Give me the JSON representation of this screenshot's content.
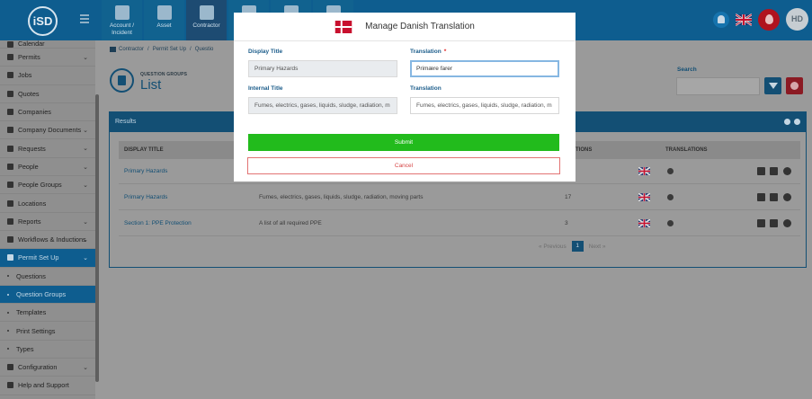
{
  "brand": {
    "logo_text": "iSD"
  },
  "topnav": {
    "tabs": [
      {
        "label_line1": "Account /",
        "label_line2": "Incident"
      },
      {
        "label_line1": "Asset",
        "label_line2": ""
      },
      {
        "label_line1": "Contractor",
        "label_line2": ""
      },
      {
        "label_line1": "",
        "label_line2": ""
      },
      {
        "label_line1": "",
        "label_line2": ""
      },
      {
        "label_line1": "",
        "label_line2": ""
      }
    ],
    "avatar_initials": "HD"
  },
  "sidebar": {
    "items": [
      {
        "label": "Calendar"
      },
      {
        "label": "Permits"
      },
      {
        "label": "Jobs"
      },
      {
        "label": "Quotes"
      },
      {
        "label": "Companies"
      },
      {
        "label": "Company Documents"
      },
      {
        "label": "Requests"
      },
      {
        "label": "People"
      },
      {
        "label": "People Groups"
      },
      {
        "label": "Locations"
      },
      {
        "label": "Reports"
      },
      {
        "label": "Workflows & Inductions"
      },
      {
        "label": "Permit Set Up"
      },
      {
        "label": "Questions"
      },
      {
        "label": "Question Groups"
      },
      {
        "label": "Templates"
      },
      {
        "label": "Print Settings"
      },
      {
        "label": "Types"
      },
      {
        "label": "Configuration"
      },
      {
        "label": "Help and Support"
      }
    ]
  },
  "breadcrumb": [
    "Contractor",
    "/",
    "Permit Set Up",
    "/",
    "Questio"
  ],
  "page": {
    "kicker": "QUESTION GROUPS",
    "title": "List"
  },
  "search": {
    "label": "Search",
    "value": ""
  },
  "results": {
    "header": "Results",
    "columns": {
      "display_title": "DISPLAY TITLE",
      "questions": "STIONS",
      "translations": "TRANSLATIONS"
    },
    "rows": [
      {
        "title": "Primary Hazards",
        "description": "",
        "count": ""
      },
      {
        "title": "Primary Hazards",
        "description": "Fumes, electrics, gases, liquids, sludge, radiation, moving parts",
        "count": "17"
      },
      {
        "title": "Section 1: PPE Protection",
        "description": "A list of all required PPE",
        "count": "3"
      }
    ],
    "pager": {
      "previous": "« Previous",
      "current": "1",
      "next": "Next »"
    }
  },
  "modal": {
    "title": "Manage  Danish  Translation",
    "display_title_label": "Display Title",
    "display_title_value": "Primary Hazards",
    "translation_label": "Translation",
    "required_mark": "*",
    "translation_value": "Primære farer",
    "internal_title_label": "Internal Title",
    "internal_title_value": "Fumes, electrics, gases, liquids, sludge, radiation, m",
    "translation2_label": "Translation",
    "translation2_value": "Fumes, electrics, gases, liquids, sludge, radiation, m",
    "submit_label": "Submit",
    "cancel_label": "Cancel"
  },
  "colors": {
    "primary": "#0e5d8f",
    "submit": "#22bb1c",
    "danger": "#b0121e"
  }
}
